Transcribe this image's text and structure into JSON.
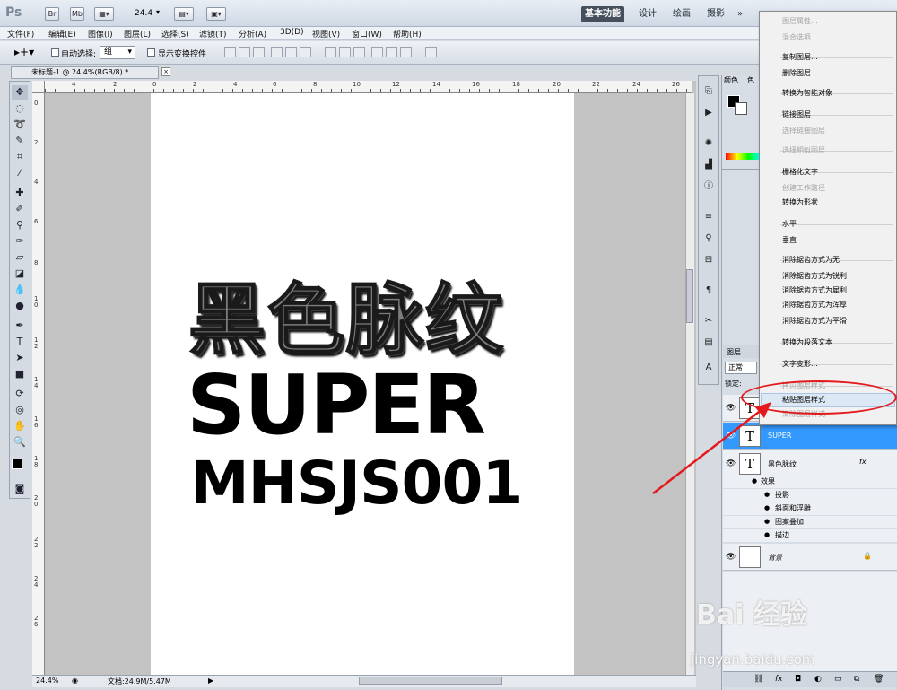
{
  "app": {
    "logo": "Ps",
    "title_buttons": [
      "Br",
      "Mb"
    ],
    "zoom_value": "24.4",
    "workspaces": [
      "基本功能",
      "设计",
      "绘画",
      "摄影",
      "»"
    ],
    "active_workspace": "基本功能"
  },
  "menubar": [
    "文件(F)",
    "编辑(E)",
    "图像(I)",
    "图层(L)",
    "选择(S)",
    "滤镜(T)",
    "分析(A)",
    "3D(D)",
    "视图(V)",
    "窗口(W)",
    "帮助(H)"
  ],
  "options": {
    "auto_select_label": "自动选择:",
    "auto_select_value": "组",
    "show_transform_label": "显示变换控件"
  },
  "document": {
    "tab_title": "未标题-1 @ 24.4%(RGB/8) *",
    "zoom_status": "24.4%",
    "doc_size": "文档:24.9M/5.47M"
  },
  "canvas": {
    "line1": "黑色脉纹",
    "line2": "SUPER",
    "line3": "MHSJS001"
  },
  "rulers": {
    "top": [
      "4",
      "2",
      "0",
      "2",
      "4",
      "6",
      "8",
      "10",
      "12",
      "14",
      "16",
      "18",
      "20",
      "22",
      "24",
      "26"
    ],
    "left": [
      "0",
      "2",
      "4",
      "6",
      "8",
      "1\n0",
      "1\n2",
      "1\n4",
      "1\n6",
      "1\n8",
      "2\n0",
      "2\n2",
      "2\n4",
      "2\n6"
    ]
  },
  "color_panel": {
    "tabs": [
      "颜色",
      "色"
    ]
  },
  "layers_panel": {
    "tab": "图层",
    "blend_mode": "正常",
    "lock_label": "锁定:",
    "layers": [
      {
        "name": "",
        "type": "text",
        "selected": false
      },
      {
        "name": "SUPER",
        "type": "text",
        "selected": true
      },
      {
        "name": "黑色脉纹",
        "type": "text",
        "selected": false,
        "fx": "fx"
      }
    ],
    "effects_label": "效果",
    "effects": [
      "投影",
      "斜面和浮雕",
      "图案叠加",
      "描边"
    ],
    "background_name": "背景"
  },
  "context_menu": {
    "items": [
      {
        "label": "图层属性...",
        "disabled": true
      },
      {
        "label": "混合选项...",
        "disabled": true
      },
      {
        "label": "复制图层...",
        "disabled": false
      },
      {
        "label": "删除图层",
        "disabled": false
      },
      {
        "label": "转换为智能对象",
        "disabled": false
      },
      {
        "label": "链接图层",
        "disabled": false
      },
      {
        "label": "选择链接图层",
        "disabled": true
      },
      {
        "label": "选择相似图层",
        "disabled": true
      },
      {
        "label": "栅格化文字",
        "disabled": false
      },
      {
        "label": "创建工作路径",
        "disabled": true
      },
      {
        "label": "转换为形状",
        "disabled": false
      },
      {
        "label": "水平",
        "disabled": false
      },
      {
        "label": "垂直",
        "disabled": false
      },
      {
        "label": "消除锯齿方式为无",
        "disabled": false
      },
      {
        "label": "消除锯齿方式为锐利",
        "disabled": false
      },
      {
        "label": "消除锯齿方式为犀利",
        "disabled": false
      },
      {
        "label": "消除锯齿方式为浑厚",
        "disabled": false
      },
      {
        "label": "消除锯齿方式为平滑",
        "disabled": false
      },
      {
        "label": "转换为段落文本",
        "disabled": false
      },
      {
        "label": "文字变形...",
        "disabled": false
      },
      {
        "label": "拷贝图层样式",
        "disabled": true
      },
      {
        "label": "粘贴图层样式",
        "disabled": false,
        "highlighted": true
      },
      {
        "label": "清除图层样式",
        "disabled": true
      }
    ]
  },
  "watermark": {
    "line1": "Bai 经验",
    "line2": "jingyan.baidu.com"
  },
  "colors": {
    "selected_layer": "#3399ff",
    "annotation": "#e3191c"
  }
}
